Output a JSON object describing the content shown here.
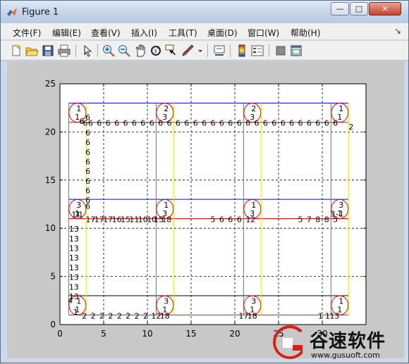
{
  "window": {
    "title": "Figure 1"
  },
  "caption": {
    "minimize": "—",
    "maximize": "□",
    "close": "✕"
  },
  "menus": [
    "文件(F)",
    "编辑(E)",
    "查看(V)",
    "插入(I)",
    "工具(T)",
    "桌面(D)",
    "窗口(W)",
    "帮助(H)"
  ],
  "toolbar": [
    "new-figure-icon",
    "open-file-icon",
    "save-icon",
    "print-icon",
    "edit-plot-icon",
    "zoom-in-icon",
    "zoom-out-icon",
    "pan-icon",
    "rotate-3d-icon",
    "data-cursor-icon",
    "brush-icon",
    "link-plot-icon",
    "colorbar-icon",
    "legend-icon",
    "hide-plot-tools-icon",
    "show-plot-tools-icon"
  ],
  "colors": {
    "blue": "#0000ff",
    "red": "#ff0000",
    "green": "#00c800",
    "yellow": "#e8e800",
    "black": "#000000",
    "grid": "#000000"
  },
  "chart_data": {
    "type": "scatter",
    "xlim": [
      0,
      35
    ],
    "ylim": [
      0,
      25
    ],
    "xticks": [
      0,
      5,
      10,
      15,
      20,
      25,
      30
    ],
    "yticks": [
      0,
      5,
      10,
      15,
      20,
      25
    ],
    "grid": true,
    "segments": [
      {
        "color": "blue",
        "x1": 1,
        "y1": 23,
        "x2": 33,
        "y2": 23
      },
      {
        "color": "red",
        "x1": 1,
        "y1": 21,
        "x2": 33,
        "y2": 21
      },
      {
        "color": "blue",
        "x1": 1,
        "y1": 13,
        "x2": 33,
        "y2": 13
      },
      {
        "color": "red",
        "x1": 1,
        "y1": 11,
        "x2": 33,
        "y2": 11
      },
      {
        "color": "black",
        "x1": 1,
        "y1": 3,
        "x2": 33,
        "y2": 3
      },
      {
        "color": "red",
        "x1": 1,
        "y1": 1,
        "x2": 33,
        "y2": 1
      },
      {
        "color": "green",
        "x1": 1,
        "y1": 1,
        "x2": 1,
        "y2": 23
      },
      {
        "color": "yellow",
        "x1": 3,
        "y1": 1,
        "x2": 3,
        "y2": 23
      },
      {
        "color": "green",
        "x1": 11,
        "y1": 1,
        "x2": 11,
        "y2": 23
      },
      {
        "color": "yellow",
        "x1": 13,
        "y1": 1,
        "x2": 13,
        "y2": 23
      },
      {
        "color": "green",
        "x1": 21,
        "y1": 1,
        "x2": 21,
        "y2": 23
      },
      {
        "color": "yellow",
        "x1": 23,
        "y1": 1,
        "x2": 23,
        "y2": 23
      },
      {
        "color": "green",
        "x1": 31,
        "y1": 1,
        "x2": 31,
        "y2": 23
      },
      {
        "color": "yellow",
        "x1": 33,
        "y1": 1,
        "x2": 33,
        "y2": 23
      }
    ],
    "circles": [
      {
        "x": 2,
        "y": 22,
        "top": "1",
        "bottom": "1"
      },
      {
        "x": 12,
        "y": 22,
        "top": "2",
        "bottom": "3"
      },
      {
        "x": 22,
        "y": 22,
        "top": "2",
        "bottom": "3"
      },
      {
        "x": 32,
        "y": 22,
        "top": "1",
        "bottom": "1"
      },
      {
        "x": 2,
        "y": 12,
        "top": "3",
        "bottom": "1"
      },
      {
        "x": 12,
        "y": 12,
        "top": "1",
        "bottom": "3"
      },
      {
        "x": 22,
        "y": 12,
        "top": "1",
        "bottom": "3"
      },
      {
        "x": 32,
        "y": 12,
        "top": "3",
        "bottom": "1"
      },
      {
        "x": 2,
        "y": 2,
        "top": "1",
        "bottom": "1"
      },
      {
        "x": 12,
        "y": 2,
        "top": "3",
        "bottom": "1"
      },
      {
        "x": 22,
        "y": 2,
        "top": "3",
        "bottom": "1"
      },
      {
        "x": 32,
        "y": 2,
        "top": "1",
        "bottom": "1"
      }
    ],
    "labels": [
      {
        "x": 2.5,
        "y": 21.2,
        "t": "6"
      },
      {
        "x": 2.9,
        "y": 21.0,
        "t": "6"
      },
      {
        "x": 3.5,
        "y": 21.0,
        "t": "6"
      },
      {
        "x": 4.5,
        "y": 21.0,
        "t": "6"
      },
      {
        "x": 5.5,
        "y": 21.0,
        "t": "6"
      },
      {
        "x": 6.5,
        "y": 21.0,
        "t": "6"
      },
      {
        "x": 7.5,
        "y": 21.0,
        "t": "6"
      },
      {
        "x": 8.5,
        "y": 21.0,
        "t": "6"
      },
      {
        "x": 9.5,
        "y": 21.0,
        "t": "6"
      },
      {
        "x": 10.5,
        "y": 21.0,
        "t": "6"
      },
      {
        "x": 11.5,
        "y": 21.0,
        "t": "6"
      },
      {
        "x": 12.5,
        "y": 21.0,
        "t": "6"
      },
      {
        "x": 13.5,
        "y": 21.0,
        "t": "6"
      },
      {
        "x": 14.5,
        "y": 21.0,
        "t": "6"
      },
      {
        "x": 15.5,
        "y": 21.0,
        "t": "6"
      },
      {
        "x": 16.5,
        "y": 21.0,
        "t": "6"
      },
      {
        "x": 17.5,
        "y": 21.0,
        "t": "6"
      },
      {
        "x": 18.5,
        "y": 21.0,
        "t": "6"
      },
      {
        "x": 19.5,
        "y": 21.0,
        "t": "6"
      },
      {
        "x": 20.5,
        "y": 21.0,
        "t": "6"
      },
      {
        "x": 21.5,
        "y": 21.0,
        "t": "6"
      },
      {
        "x": 22.5,
        "y": 21.0,
        "t": "6"
      },
      {
        "x": 23.5,
        "y": 21.0,
        "t": "6"
      },
      {
        "x": 24.5,
        "y": 21.0,
        "t": "6"
      },
      {
        "x": 25.5,
        "y": 21.0,
        "t": "6"
      },
      {
        "x": 26.5,
        "y": 21.0,
        "t": "6"
      },
      {
        "x": 27.5,
        "y": 21.0,
        "t": "6"
      },
      {
        "x": 28.5,
        "y": 21.0,
        "t": "6"
      },
      {
        "x": 29.5,
        "y": 21.0,
        "t": "6"
      },
      {
        "x": 30.5,
        "y": 21.0,
        "t": "6"
      },
      {
        "x": 31.5,
        "y": 21.0,
        "t": "6"
      },
      {
        "x": 33.3,
        "y": 20.6,
        "t": "2"
      },
      {
        "x": 3.2,
        "y": 21.6,
        "t": "6"
      },
      {
        "x": 3.2,
        "y": 20.0,
        "t": "6"
      },
      {
        "x": 3.2,
        "y": 19.0,
        "t": "6"
      },
      {
        "x": 3.2,
        "y": 18.0,
        "t": "6"
      },
      {
        "x": 3.2,
        "y": 17.0,
        "t": "6"
      },
      {
        "x": 3.2,
        "y": 16.0,
        "t": "6"
      },
      {
        "x": 3.2,
        "y": 15.0,
        "t": "6"
      },
      {
        "x": 3.2,
        "y": 14.0,
        "t": "6"
      },
      {
        "x": 3.2,
        "y": 13.0,
        "t": "6"
      },
      {
        "x": 3.2,
        "y": 12.4,
        "t": "6"
      },
      {
        "x": 1.6,
        "y": 11.5,
        "t": "1"
      },
      {
        "x": 2.0,
        "y": 11.5,
        "t": "3"
      },
      {
        "x": 2.4,
        "y": 11.5,
        "t": "1"
      },
      {
        "x": 3.5,
        "y": 11.0,
        "t": "17"
      },
      {
        "x": 4.5,
        "y": 11.0,
        "t": "17"
      },
      {
        "x": 5.5,
        "y": 11.0,
        "t": "17"
      },
      {
        "x": 6.5,
        "y": 11.0,
        "t": "16"
      },
      {
        "x": 7.5,
        "y": 11.0,
        "t": "15"
      },
      {
        "x": 8.5,
        "y": 11.0,
        "t": "11"
      },
      {
        "x": 9.5,
        "y": 11.0,
        "t": "10"
      },
      {
        "x": 10.5,
        "y": 11.0,
        "t": "10"
      },
      {
        "x": 11.3,
        "y": 11.0,
        "t": "15"
      },
      {
        "x": 12.2,
        "y": 11.0,
        "t": "18"
      },
      {
        "x": 17.5,
        "y": 11.0,
        "t": "5"
      },
      {
        "x": 18.5,
        "y": 11.0,
        "t": "6"
      },
      {
        "x": 19.5,
        "y": 11.0,
        "t": "6"
      },
      {
        "x": 20.5,
        "y": 11.0,
        "t": "6"
      },
      {
        "x": 21.8,
        "y": 11.0,
        "t": "12"
      },
      {
        "x": 27.5,
        "y": 11.0,
        "t": "5"
      },
      {
        "x": 28.5,
        "y": 11.0,
        "t": "7"
      },
      {
        "x": 29.5,
        "y": 11.0,
        "t": "8"
      },
      {
        "x": 30.5,
        "y": 11.0,
        "t": "8"
      },
      {
        "x": 31.5,
        "y": 11.0,
        "t": "5"
      },
      {
        "x": 31.2,
        "y": 11.6,
        "t": "3"
      },
      {
        "x": 31.7,
        "y": 11.6,
        "t": "-"
      },
      {
        "x": 32.2,
        "y": 11.6,
        "t": "1"
      },
      {
        "x": 1.6,
        "y": 10.0,
        "t": "13"
      },
      {
        "x": 1.6,
        "y": 9.0,
        "t": "13"
      },
      {
        "x": 1.6,
        "y": 8.0,
        "t": "13"
      },
      {
        "x": 1.6,
        "y": 7.0,
        "t": "13"
      },
      {
        "x": 1.6,
        "y": 6.0,
        "t": "13"
      },
      {
        "x": 1.6,
        "y": 5.0,
        "t": "13"
      },
      {
        "x": 1.6,
        "y": 4.0,
        "t": "13"
      },
      {
        "x": 1.6,
        "y": 3.0,
        "t": "13"
      },
      {
        "x": 1.2,
        "y": 2.6,
        "t": "4"
      },
      {
        "x": 1.8,
        "y": 1.4,
        "t": "1"
      },
      {
        "x": 2.8,
        "y": 1.0,
        "t": "2"
      },
      {
        "x": 3.8,
        "y": 1.0,
        "t": "2"
      },
      {
        "x": 4.8,
        "y": 1.0,
        "t": "2"
      },
      {
        "x": 5.8,
        "y": 1.0,
        "t": "2"
      },
      {
        "x": 6.8,
        "y": 1.0,
        "t": "2"
      },
      {
        "x": 7.8,
        "y": 1.0,
        "t": "2"
      },
      {
        "x": 8.8,
        "y": 1.0,
        "t": "2"
      },
      {
        "x": 9.8,
        "y": 1.0,
        "t": "2"
      },
      {
        "x": 11.0,
        "y": 1.0,
        "t": "12"
      },
      {
        "x": 12.0,
        "y": 1.0,
        "t": "18"
      },
      {
        "x": 21.0,
        "y": 1.0,
        "t": "17"
      },
      {
        "x": 22.0,
        "y": 1.0,
        "t": "18"
      },
      {
        "x": 29.8,
        "y": 1.0,
        "t": "1"
      },
      {
        "x": 30.6,
        "y": 1.0,
        "t": "1"
      },
      {
        "x": 31.4,
        "y": 1.0,
        "t": "13"
      }
    ]
  },
  "watermark": {
    "text": "谷速软件",
    "url": "www.gusuoft.com"
  }
}
